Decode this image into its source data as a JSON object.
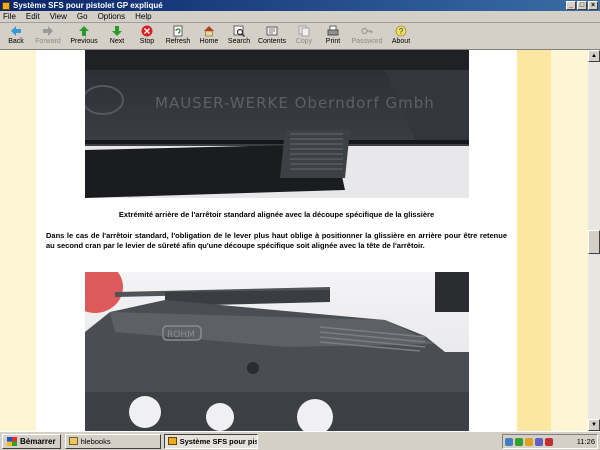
{
  "window": {
    "title": "Système SFS pour pistolet GP expliqué"
  },
  "menu": [
    "File",
    "Edit",
    "View",
    "Go",
    "Options",
    "Help"
  ],
  "toolbar": {
    "back": "Back",
    "forward": "Forward",
    "previous": "Previous",
    "next": "Next",
    "stop": "Stop",
    "refresh": "Refresh",
    "home": "Home",
    "search": "Search",
    "contents": "Contents",
    "copy": "Copy",
    "print": "Print",
    "password": "Password",
    "about": "About"
  },
  "content": {
    "photo1_engraving": "MAUSER-WERKE Oberndorf Gmbh",
    "caption1": "Extrémité arrière de l'arrêtoir standard alignée avec la découpe spécifique de la glissière",
    "paragraph": "Dans le cas de l'arrêtoir standard, l'obligation de le lever plus haut oblige à positionner la glissière en arrière pour être retenue au second cran par le levier de sûreté afin qu'une découpe spécifique soit alignée avec la tête de l'arrêtoir.",
    "photo2_logo": "ROHM"
  },
  "taskbar": {
    "start": "Bémarrer",
    "tasks": [
      "hlebooks",
      "Système SFS pour pis..."
    ],
    "clock": "11:26"
  },
  "colors": {
    "stripe_light": "#fdf5d3",
    "stripe_dark": "#fde6a0",
    "titlebar": "#0a246a"
  }
}
